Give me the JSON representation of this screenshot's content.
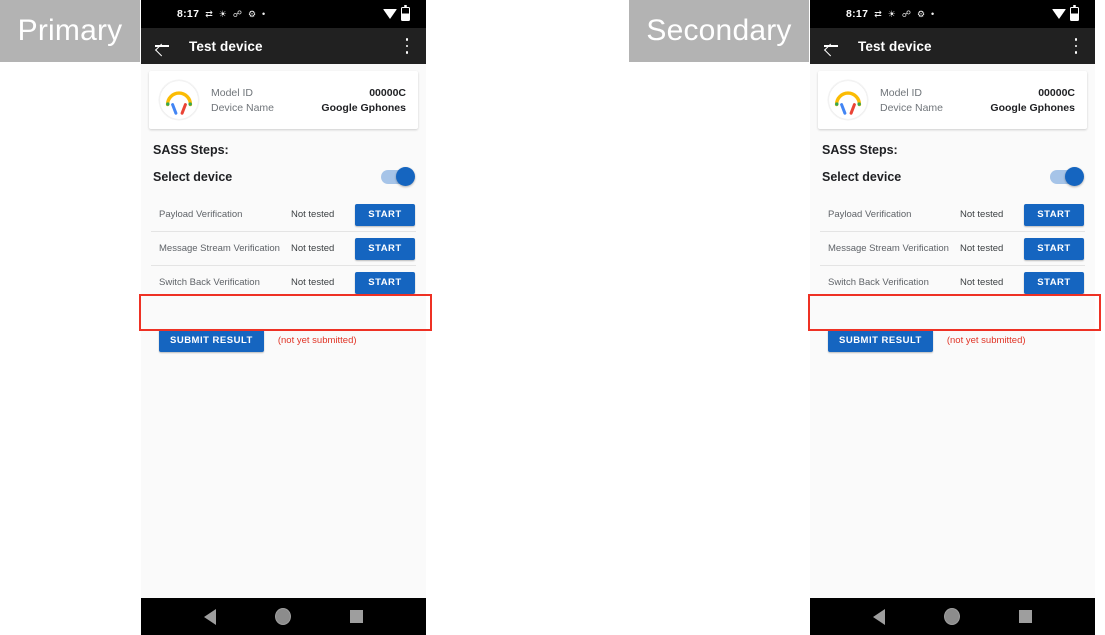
{
  "annotations": {
    "primary_label": "Primary",
    "secondary_label": "Secondary",
    "highlight_color": "#ee3124",
    "label_bg": "#b3b3b3"
  },
  "phone": {
    "status_bar": {
      "time": "8:17",
      "icons": [
        "sync-icon",
        "brightness-icon",
        "bluetooth-icon",
        "location-icon",
        "dot-icon"
      ],
      "right_icons": [
        "wifi-icon",
        "battery-icon"
      ]
    },
    "app_bar": {
      "back_icon": "back-arrow-icon",
      "title": "Test device",
      "overflow_icon": "kebab-menu-icon"
    },
    "device_card": {
      "icon": "headphones-device-icon",
      "rows": [
        {
          "key": "Model ID",
          "value": "00000C"
        },
        {
          "key": "Device Name",
          "value": "Google Gphones"
        }
      ]
    },
    "section": {
      "title": "SASS Steps:",
      "select_device_label": "Select device",
      "select_device_on": true
    },
    "tests": [
      {
        "name": "Payload Verification",
        "status": "Not tested",
        "action": "START"
      },
      {
        "name": "Message Stream Verification",
        "status": "Not tested",
        "action": "START"
      },
      {
        "name": "Switch Back Verification",
        "status": "Not tested",
        "action": "START"
      }
    ],
    "submit": {
      "button": "SUBMIT RESULT",
      "note": "(not yet submitted)"
    },
    "nav_bar": {
      "back": "nav-back-icon",
      "home": "nav-home-icon",
      "recents": "nav-recents-icon"
    },
    "colors": {
      "accent_blue": "#1565c0",
      "app_bar": "#212121",
      "background": "#fafafa",
      "note_red": "#e03426"
    }
  }
}
